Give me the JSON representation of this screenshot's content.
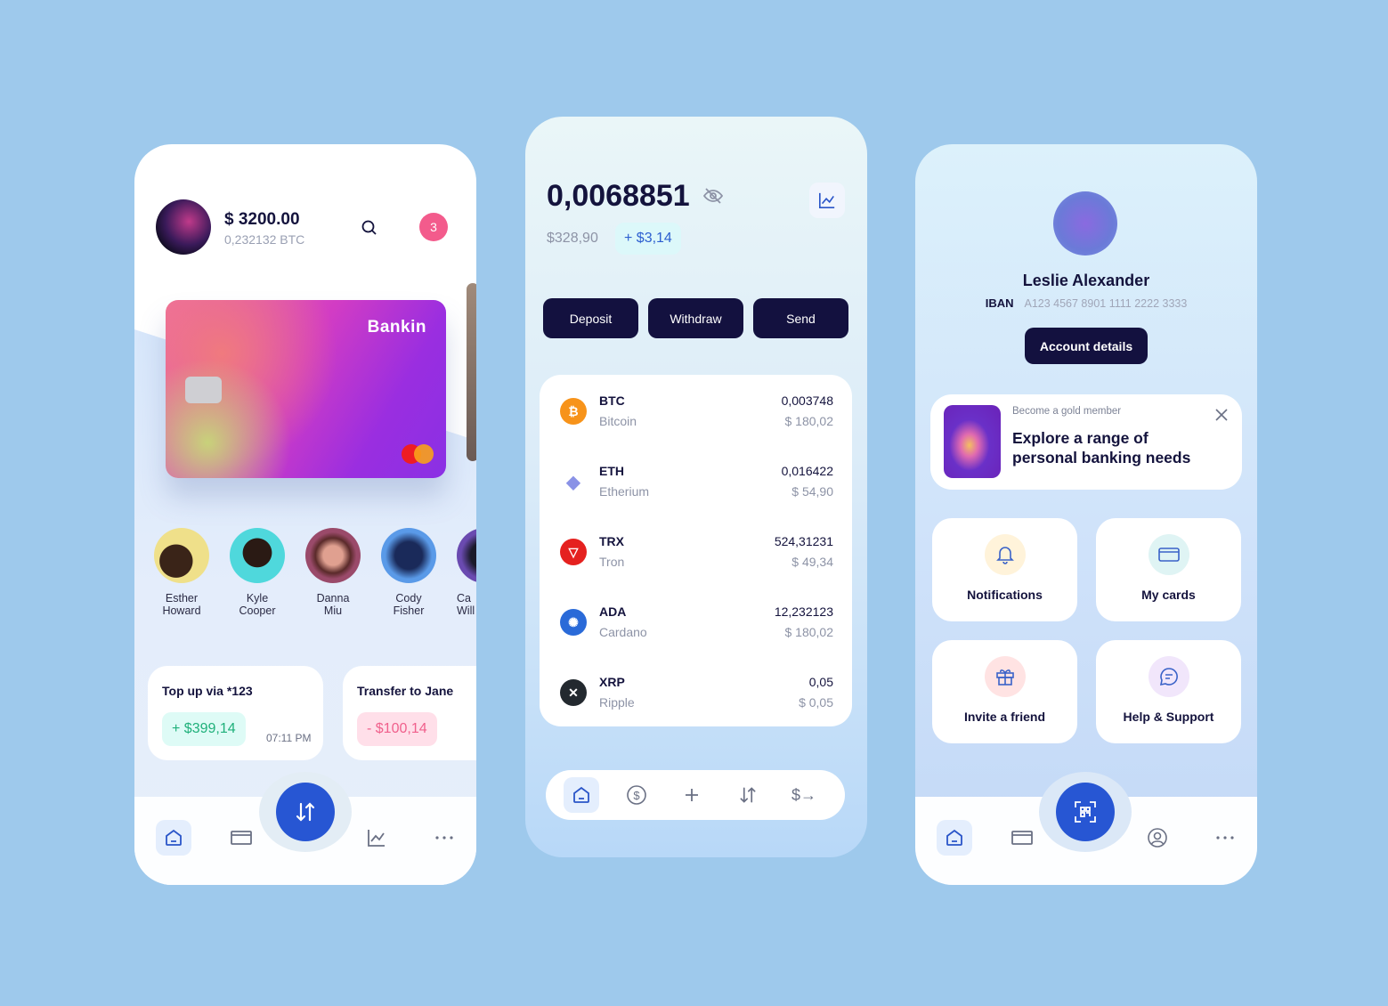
{
  "colors": {
    "page_bg": "#9ec9ec",
    "primary_dark": "#13113f",
    "accent_blue": "#2756d3",
    "positive": "#1fb07a",
    "negative": "#f0608c",
    "badge": "#f35b8c"
  },
  "wallet": {
    "balance": "$ 3200.00",
    "balance_btc": "0,232132 BTC",
    "notification_count": "3",
    "card_brand": "Bankin",
    "contacts": [
      {
        "first": "Esther",
        "last": "Howard"
      },
      {
        "first": "Kyle",
        "last": "Cooper"
      },
      {
        "first": "Danna",
        "last": "Miu"
      },
      {
        "first": "Cody",
        "last": "Fisher"
      },
      {
        "first": "Ca",
        "last": "Will"
      }
    ],
    "transactions": [
      {
        "title": "Top up via *123",
        "amount": "+ $399,14",
        "time": "07:11 PM",
        "type": "credit"
      },
      {
        "title": "Transfer to Jane",
        "amount": "- $100,14",
        "type": "debit"
      }
    ],
    "nav": [
      "home-icon",
      "card-icon",
      "transfer-icon",
      "chart-icon",
      "more-icon"
    ]
  },
  "crypto": {
    "total": "0,0068851",
    "usd_value": "$328,90",
    "change": "+ $3,14",
    "actions": [
      "Deposit",
      "Withdraw",
      "Send"
    ],
    "assets": [
      {
        "symbol": "BTC",
        "name": "Bitcoin",
        "amount": "0,003748",
        "usd": "$ 180,02",
        "color": "#f7931a"
      },
      {
        "symbol": "ETH",
        "name": "Etherium",
        "amount": "0,016422",
        "usd": "$ 54,90",
        "color": "#8a92e6"
      },
      {
        "symbol": "TRX",
        "name": "Tron",
        "amount": "524,31231",
        "usd": "$ 49,34",
        "color": "#e5211f"
      },
      {
        "symbol": "ADA",
        "name": "Cardano",
        "amount": "12,232123",
        "usd": "$ 180,02",
        "color": "#2a6ad8"
      },
      {
        "symbol": "XRP",
        "name": "Ripple",
        "amount": "0,05",
        "usd": "$ 0,05",
        "color": "#23292f"
      }
    ],
    "nav": [
      "home-icon",
      "dollar-icon",
      "plus-icon",
      "transfer-icon",
      "send-money-icon"
    ]
  },
  "profile": {
    "name": "Leslie Alexander",
    "iban_label": "IBAN",
    "iban": "A123 4567 8901 1111 2222 3333",
    "account_button": "Account details",
    "promo": {
      "kicker": "Become a gold member",
      "headline": "Explore a range of personal banking needs"
    },
    "tiles": [
      {
        "label": "Notifications",
        "icon": "bell-icon"
      },
      {
        "label": "My cards",
        "icon": "card-icon"
      },
      {
        "label": "Invite a friend",
        "icon": "gift-icon"
      },
      {
        "label": "Help & Support",
        "icon": "chat-icon"
      }
    ],
    "nav": [
      "home-icon",
      "card-icon",
      "qr-scan-icon",
      "profile-icon",
      "more-icon"
    ]
  }
}
